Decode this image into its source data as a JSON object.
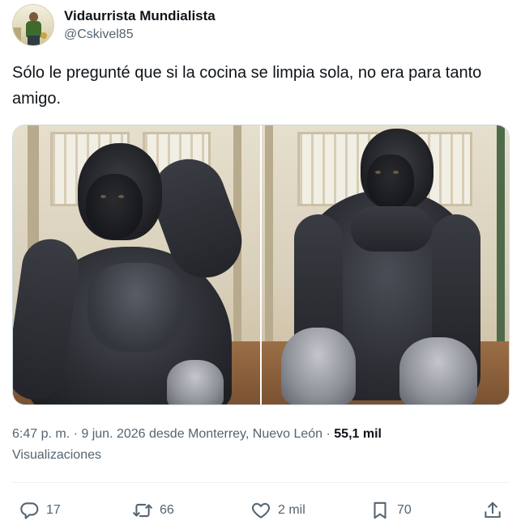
{
  "author": {
    "display_name": "Vidaurrista Mundialista",
    "handle": "@Cskivel85"
  },
  "tweet": {
    "text": "Sólo le pregunté que si la cocina se limpia sola, no era para tanto amigo."
  },
  "meta": {
    "timestamp": "6:47 p. m. · 9 jun. 2026 desde Monterrey, Nuevo León ·",
    "views_count": "55,1 mil",
    "views_label": "Visualizaciones"
  },
  "actions": {
    "reply": {
      "icon": "reply-icon",
      "count": "17"
    },
    "retweet": {
      "icon": "retweet-icon",
      "count": "66"
    },
    "like": {
      "icon": "heart-icon",
      "count": "2 mil"
    },
    "bookmark": {
      "icon": "bookmark-icon",
      "count": "70"
    },
    "share": {
      "icon": "share-icon"
    }
  },
  "colors": {
    "text_primary": "#0f1419",
    "text_secondary": "#536471",
    "border": "#cfd9de",
    "divider": "#eff3f4"
  }
}
